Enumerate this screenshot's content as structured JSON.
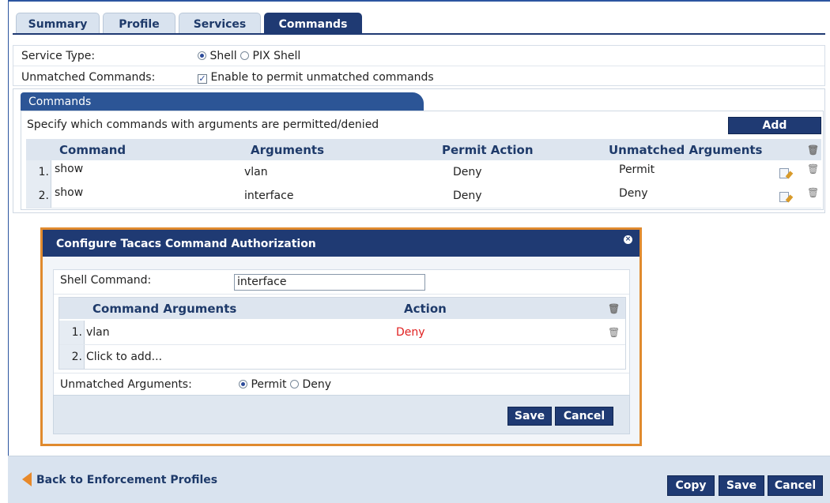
{
  "tabs": [
    "Summary",
    "Profile",
    "Services",
    "Commands"
  ],
  "service_type": {
    "label": "Service Type:",
    "opt1": "Shell",
    "opt2": "PIX Shell"
  },
  "unmatched": {
    "label": "Unmatched Commands:",
    "text": "Enable to permit unmatched commands"
  },
  "commands": {
    "section_title": "Commands",
    "desc": "Specify which commands with arguments are permitted/denied",
    "add_label": "Add",
    "headers": [
      "Command",
      "Arguments",
      "Permit Action",
      "Unmatched Arguments"
    ],
    "rows": [
      {
        "num": "1.",
        "command": "show",
        "arguments": "vlan",
        "permit": "Deny",
        "unmatched": "Permit"
      },
      {
        "num": "2.",
        "command": "show",
        "arguments": "interface",
        "permit": "Deny",
        "unmatched": "Deny"
      }
    ]
  },
  "modal": {
    "title": "Configure Tacacs Command Authorization",
    "shell_label": "Shell Command:",
    "shell_value": "interface",
    "headers": [
      "Command Arguments",
      "Action"
    ],
    "rows": [
      {
        "num": "1.",
        "arg": "vlan",
        "action": "Deny"
      },
      {
        "num": "2.",
        "arg": "Click to add...",
        "action": ""
      }
    ],
    "unmatched_label": "Unmatched Arguments:",
    "opt1": "Permit",
    "opt2": "Deny",
    "save": "Save",
    "cancel": "Cancel",
    "deny_color": "#e02020"
  },
  "footer": {
    "back": "Back to Enforcement Profiles",
    "copy": "Copy",
    "save": "Save",
    "cancel": "Cancel"
  }
}
